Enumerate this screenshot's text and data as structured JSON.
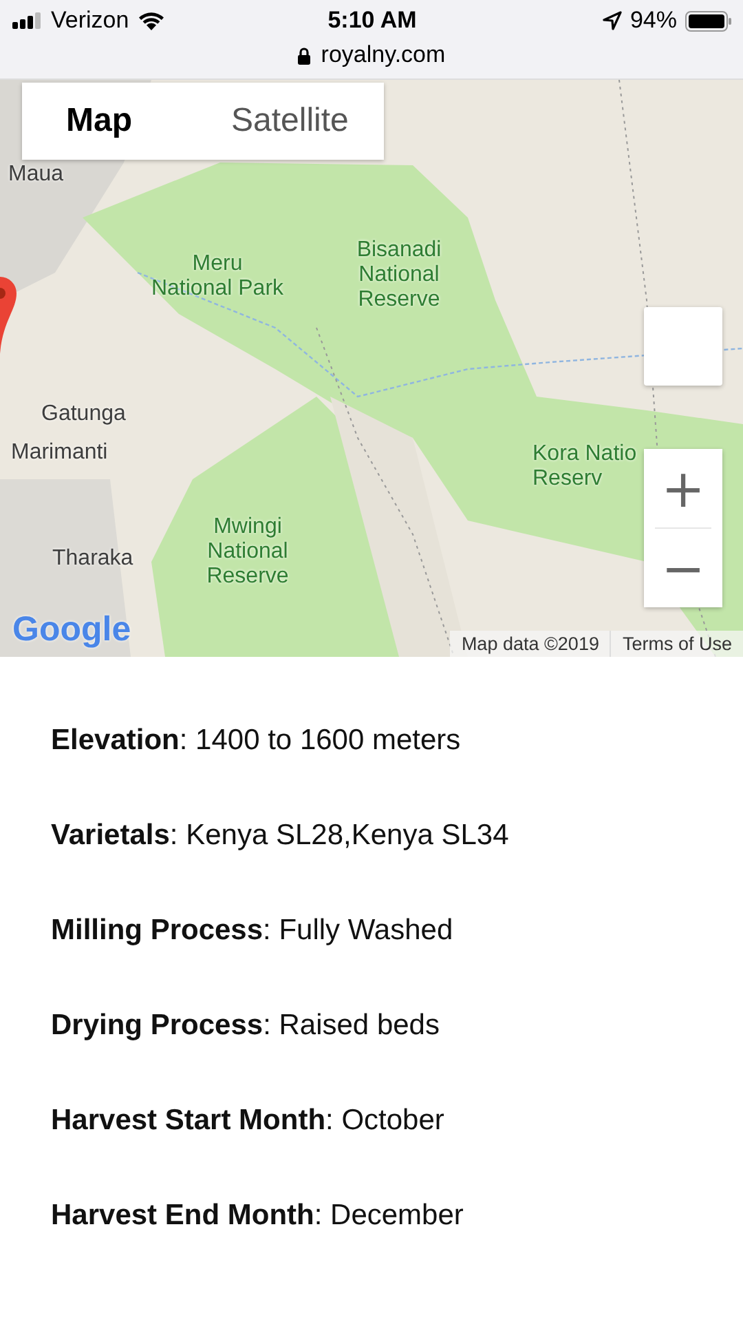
{
  "status_bar": {
    "carrier": "Verizon",
    "time": "5:10 AM",
    "battery": "94%"
  },
  "address_bar": {
    "url": "royalny.com"
  },
  "map": {
    "tabs": [
      {
        "label": "Map",
        "selected": true
      },
      {
        "label": "Satellite",
        "selected": false
      }
    ],
    "labels": [
      {
        "lines": [
          "Maua"
        ]
      },
      {
        "lines": [
          "Meru",
          "National Park"
        ]
      },
      {
        "lines": [
          "Bisanadi",
          "National",
          "Reserve"
        ]
      },
      {
        "lines": [
          "Gatunga"
        ]
      },
      {
        "lines": [
          "Marimanti"
        ]
      },
      {
        "lines": [
          "Kora Natio",
          "Reserv"
        ]
      },
      {
        "lines": [
          "Tharaka"
        ]
      },
      {
        "lines": [
          "Mwingi",
          "National",
          "Reserve"
        ]
      }
    ],
    "zoom_in": "+",
    "zoom_out": "−",
    "logo": "Google",
    "attribution": "Map data ©2019",
    "terms": "Terms of Use"
  },
  "details": [
    {
      "text": "**Elevation**: 1400 to 1600 meters"
    },
    {
      "text": "**Varietals**: Kenya SL28,Kenya SL34"
    },
    {
      "text": "**Milling Process**: Fully Washed"
    },
    {
      "text": "**Drying Process**: Raised beds"
    },
    {
      "text": "**Harvest Start Month**: October"
    },
    {
      "text": "**Harvest End Month**: December"
    }
  ]
}
